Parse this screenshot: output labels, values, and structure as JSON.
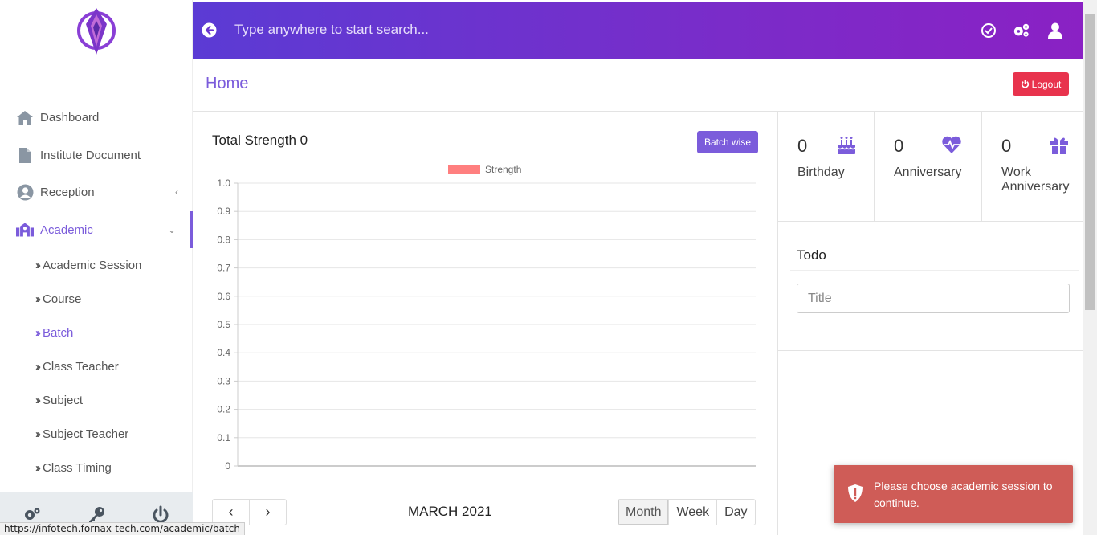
{
  "sidebar": {
    "items": [
      {
        "label": "Dashboard",
        "icon": "home-icon"
      },
      {
        "label": "Institute Document",
        "icon": "document-icon"
      },
      {
        "label": "Reception",
        "icon": "user-circle-icon"
      },
      {
        "label": "Academic",
        "icon": "school-icon"
      }
    ],
    "sub_items": [
      "Academic Session",
      "Course",
      "Batch",
      "Class Teacher",
      "Subject",
      "Subject Teacher",
      "Class Timing"
    ],
    "active_sub": "Batch",
    "footer_icons": [
      "settings-icon",
      "key-icon",
      "power-icon"
    ]
  },
  "header": {
    "search_placeholder": "Type anywhere to start search...",
    "icons": [
      "check-circle-icon",
      "cogs-icon",
      "user-icon"
    ]
  },
  "page": {
    "title": "Home",
    "logout_label": "Logout"
  },
  "chart_panel": {
    "title": "Total Strength 0",
    "batch_button": "Batch wise"
  },
  "chart_data": {
    "type": "bar",
    "categories": [],
    "series": [
      {
        "name": "Strength",
        "values": [],
        "color": "#ff7f7f"
      }
    ],
    "ylim": [
      0,
      1
    ],
    "yticks": [
      "1.0",
      "0.9",
      "0.8",
      "0.7",
      "0.6",
      "0.5",
      "0.4",
      "0.3",
      "0.2",
      "0.1",
      "0"
    ],
    "legend_position": "top",
    "grid": true
  },
  "calendar": {
    "month_label": "MARCH 2021",
    "prev": "‹",
    "next": "›",
    "views": [
      "Month",
      "Week",
      "Day"
    ],
    "active_view": "Month"
  },
  "stats": [
    {
      "count": "0",
      "label": "Birthday",
      "icon": "cake-icon"
    },
    {
      "count": "0",
      "label": "Anniversary",
      "icon": "heartbeat-icon"
    },
    {
      "count": "0",
      "label": "Work Anniversary",
      "icon": "gift-icon"
    }
  ],
  "todo": {
    "title": "Todo",
    "input_placeholder": "Title"
  },
  "toast": {
    "message": "Please choose academic session to continue."
  },
  "status_bar": {
    "url": "https://infotech.fornax-tech.com/academic/batch"
  },
  "colors": {
    "accent": "#7b5cdb",
    "header_start": "#5b3bd4",
    "header_end": "#8a21c4",
    "logout": "#e8334d",
    "toast": "#cf5c57"
  }
}
